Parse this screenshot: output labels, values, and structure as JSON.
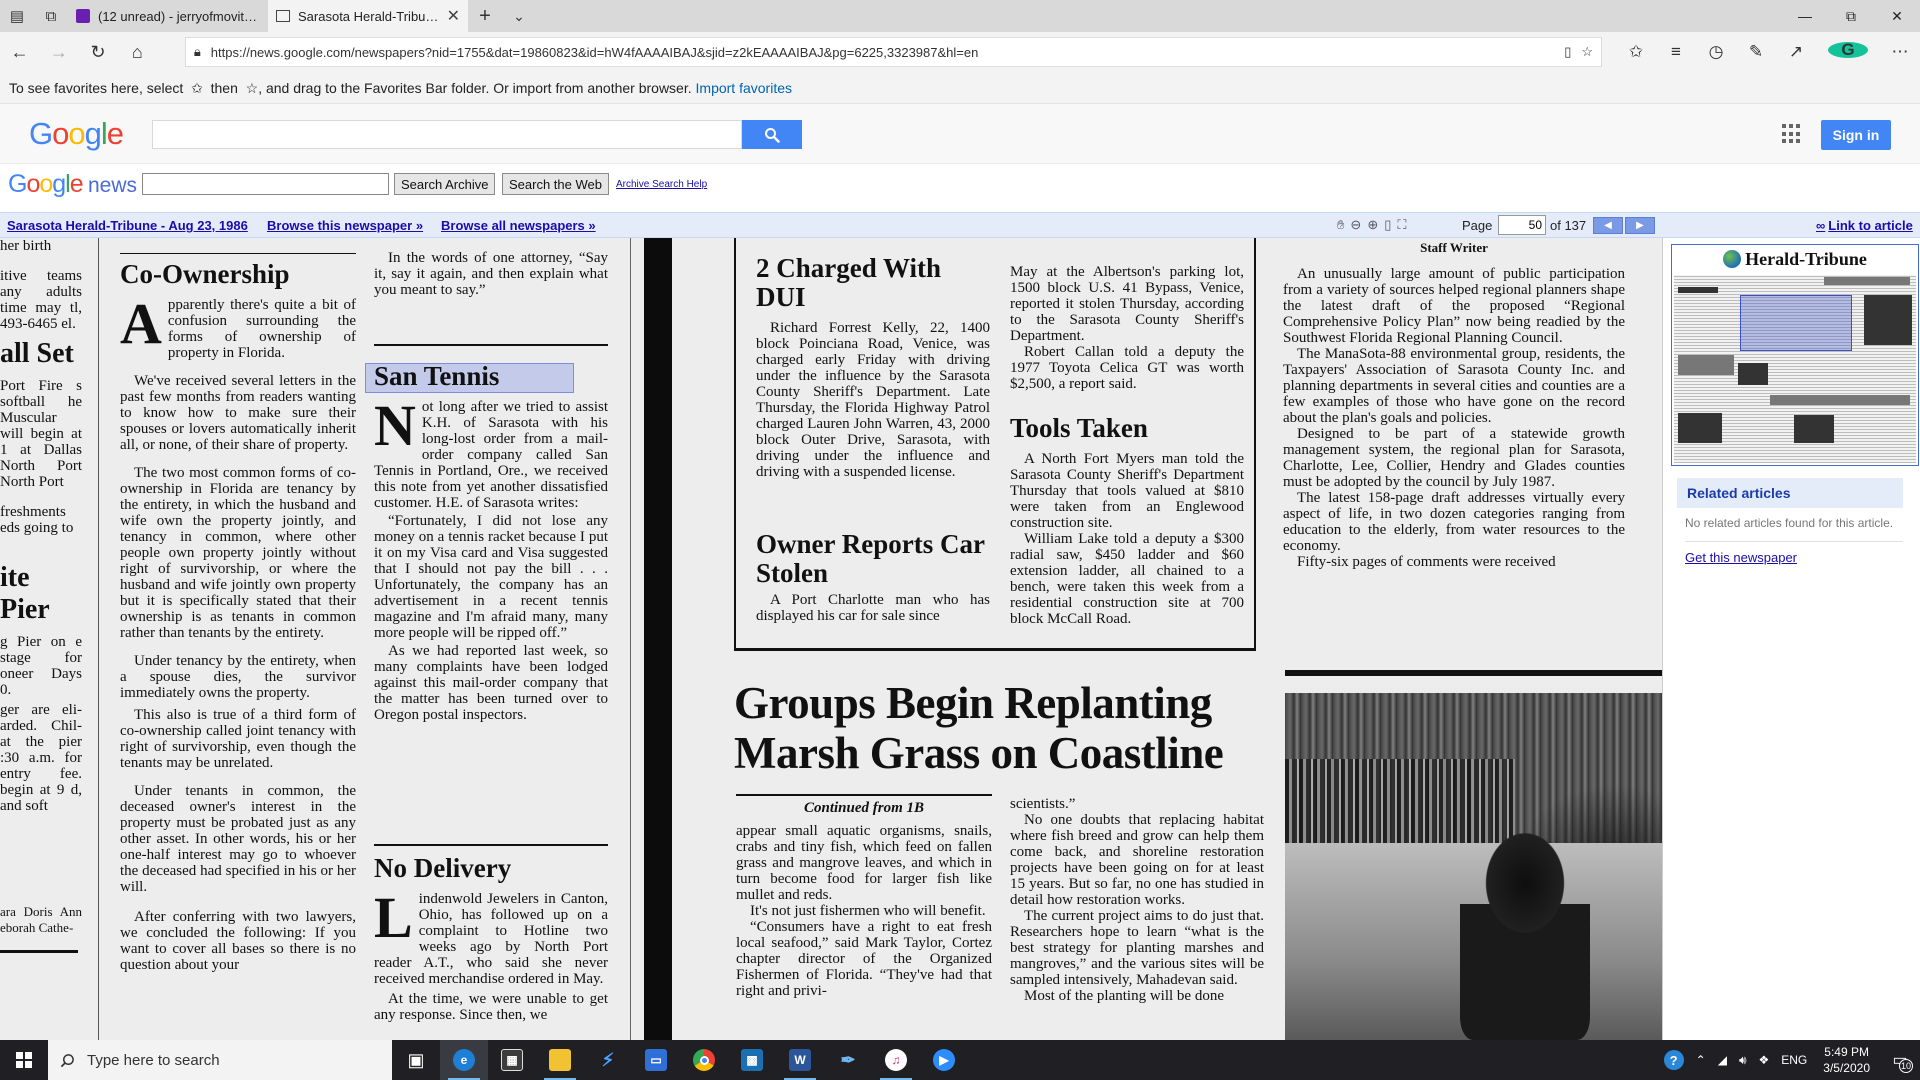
{
  "browser": {
    "tabs": [
      {
        "title": "(12 unread) - jerryofmovite…",
        "icon": "yahoo-mail-icon"
      },
      {
        "title": "Sarasota Herald-Tribune",
        "icon": "page-icon"
      }
    ],
    "url": "https://news.google.com/newspapers?nid=1755&dat=19860823&id=hW4fAAAAIBAJ&sjid=z2kEAAAAIBAJ&pg=6225,3323987&hl=en",
    "favorites_bar": {
      "message_before": "To see favorites here, select",
      "message_mid": "then",
      "message_after": ", and drag to the Favorites Bar folder. Or import from another browser.",
      "import_link": "Import favorites"
    },
    "colors": {
      "tab_bar": "#d9d9d9",
      "toolbar": "#f3f3f3",
      "link": "#0063b1"
    }
  },
  "google_header": {
    "logo": [
      "G",
      "o",
      "o",
      "g",
      "l",
      "e"
    ],
    "signin_label": "Sign in",
    "colors": {
      "blue": "#4285f4",
      "red": "#ea4335",
      "yellow": "#fbbc05",
      "green": "#34a853"
    }
  },
  "news_row": {
    "logo_news": "news",
    "search_archive_label": "Search Archive",
    "search_web_label": "Search the Web",
    "help_link": "Archive Search Help"
  },
  "paper_nav": {
    "paper_link": "Sarasota Herald-Tribune - Aug 23, 1986",
    "browse_paper": "Browse this newspaper »",
    "browse_all": "Browse all newspapers »",
    "page_label": "Page",
    "page_value": "50",
    "page_of": "of 137",
    "link_to_article": "Link to article"
  },
  "newspaper": {
    "col0": {
      "line1": "her birth",
      "block1": "itive teams any adults time may tl, 493-6465 el.",
      "head1": "all Set",
      "block2": "Port Fire s softball he Muscular will begin at 1 at Dallas North Port North Port",
      "block3": "freshments eds going to",
      "head2": "ite Pier",
      "block4": "g Pier on e stage for oneer Days 0.",
      "block5": "ger are eli- arded. Chil- at the pier :30 a.m. for entry fee. begin at 9 d, and soft",
      "block6": "ara Doris Ann eborah Cathe-"
    },
    "coownership": {
      "headline": "Co-Ownership",
      "dropcap": "A",
      "p1": "pparently there's quite a bit of confusion surrounding the forms of ownership of property in Florida.",
      "p2": "We've received several letters in the past few months from readers wanting to know how to make sure their spouses or lovers automatically inherit all, or none, of their share of property.",
      "p3": "The two most common forms of co-ownership in Florida are tenancy by the entirety, in which the husband and wife own the property jointly, and tenancy in common, where other people own property jointly without right of survivorship, or where the husband and wife jointly own property but it is specifically stated that their ownership is as tenants in common rather than tenants by the entirety.",
      "p4": "Under tenancy by the entirety, when a spouse dies, the survivor immediately owns the property.",
      "p5": "This also is true of a third form of co-ownership called joint tenancy with right of survivorship, even though the tenants may be unrelated.",
      "p6": "Under tenants in common, the deceased owner's interest in the property must be probated just as any other asset. In other words, his or her one-half interest may go to whoever the deceased had specified in his or her will.",
      "p7": "After conferring with two lawyers, we concluded the following: If you want to cover all bases so there is no question about your"
    },
    "san_tennis": {
      "intro": "In the words of one attorney, “Say it, say it again, and then explain what you meant to say.”",
      "headline": "San Tennis",
      "dropcap": "N",
      "p1": "ot long after we tried to assist K.H. of Sarasota with his long-lost order from a mail-order company called San Tennis in Portland, Ore., we received this note from yet another dissatisfied customer. H.E. of Sarasota writes:",
      "p2": "“Fortunately, I did not lose any money on a tennis racket because I put it on my Visa card and Visa suggested that I should not pay the bill . . . Unfortunately, the company has an advertisement in a recent tennis magazine and I'm afraid many, many more people will be ripped off.”",
      "p3": "As we had reported last week, so many complaints have been lodged against this mail-order company that the matter has been turned over to Oregon postal inspectors."
    },
    "no_delivery": {
      "headline": "No Delivery",
      "dropcap": "L",
      "p1": "indenwold Jewelers in Canton, Ohio, has followed up on a complaint to Hotline two weeks ago by North Port reader A.T., who said she never received merchandise ordered in May.",
      "p2": "At the time, we were unable to get any response. Since then, we"
    },
    "dui": {
      "headline": "2 Charged With DUI",
      "p1": "Richard Forrest Kelly, 22, 1400 block Poinciana Road, Venice, was charged early Friday with driving under the influence by the Sarasota County Sheriff's Department. Late Thursday, the Florida Highway Patrol charged Lauren John Warren, 43, 2000 block Outer Drive, Sarasota, with driving under the influence and driving with a suspended license."
    },
    "car_stolen": {
      "headline": "Owner Reports Car Stolen",
      "p1": "A Port Charlotte man who has displayed his car for sale since"
    },
    "albertsons": {
      "p1": "May at the Albertson's parking lot, 1500 block U.S. 41 Bypass, Venice, reported it stolen Thursday, according to the Sarasota County Sheriff's Department.",
      "p2": "Robert Callan told a deputy the 1977 Toyota Celica GT was worth $2,500, a report said."
    },
    "tools": {
      "headline": "Tools Taken",
      "p1": "A North Fort Myers man told the Sarasota County Sheriff's Department Thursday that tools valued at $810 were taken from an Englewood construction site.",
      "p2": "William Lake told a deputy a $300 radial saw, $450 ladder and $60 extension ladder, all chained to a bench, were taken this week from a residential construction site at 700 block McCall Road."
    },
    "planning": {
      "byline": "Staff Writer",
      "p1": "An unusually large amount of public participation from a variety of sources helped regional planners shape the latest draft of the proposed “Regional Comprehensive Policy Plan” now being readied by the Southwest Florida Regional Planning Council.",
      "p2": "The ManaSota-88 environmental group, residents, the Taxpayers' Association of Sarasota County Inc. and planning departments in several cities and counties are a few examples of those who have gone on the record about the plan's goals and policies.",
      "p3": "Designed to be part of a statewide growth management system, the regional plan for Sarasota, Charlotte, Lee, Collier, Hendry and Glades counties must be adopted by the council by July 1987.",
      "p4": "The latest 158-page draft addresses virtually every aspect of life, in two dozen categories ranging from education to the elderly, from water resources to the economy.",
      "p5": "Fifty-six pages of comments were received"
    },
    "marsh": {
      "headline": "Groups Begin Replanting Marsh Grass on Coastline",
      "continued": "Continued from 1B",
      "c1p1": "appear small aquatic organisms, snails, crabs and tiny fish, which feed on fallen grass and mangrove leaves, and which in turn become food for larger fish like mullet and reds.",
      "c1p2": "It's not just fishermen who will benefit.",
      "c1p3": "“Consumers have a right to eat fresh local seafood,” said Mark Taylor, Cortez chapter director of the Organized Fishermen of Florida. “They've had that right and privi-",
      "c2p0": "scientists.”",
      "c2p1": "No one doubts that replacing habitat where fish breed and grow can help them come back, and shoreline restoration projects have been going on for at least 15 years. But so far, no one has studied in detail how restoration works.",
      "c2p2": "The current project aims to do just that. Researchers hope to learn “what is the best strategy for planting marshes and mangroves,” and the various sites will be sampled intensively, Mahadevan said.",
      "c2p3": "Most of the planting will be done"
    }
  },
  "sidebar": {
    "thumb_title": "Herald-Tribune",
    "related_title": "Related articles",
    "related_none": "No related articles found for this article.",
    "get_newspaper": "Get this newspaper"
  },
  "taskbar": {
    "search_placeholder": "Type here to search",
    "lang": "ENG",
    "time": "5:49 PM",
    "date": "3/5/2020",
    "notification_count": "10"
  }
}
